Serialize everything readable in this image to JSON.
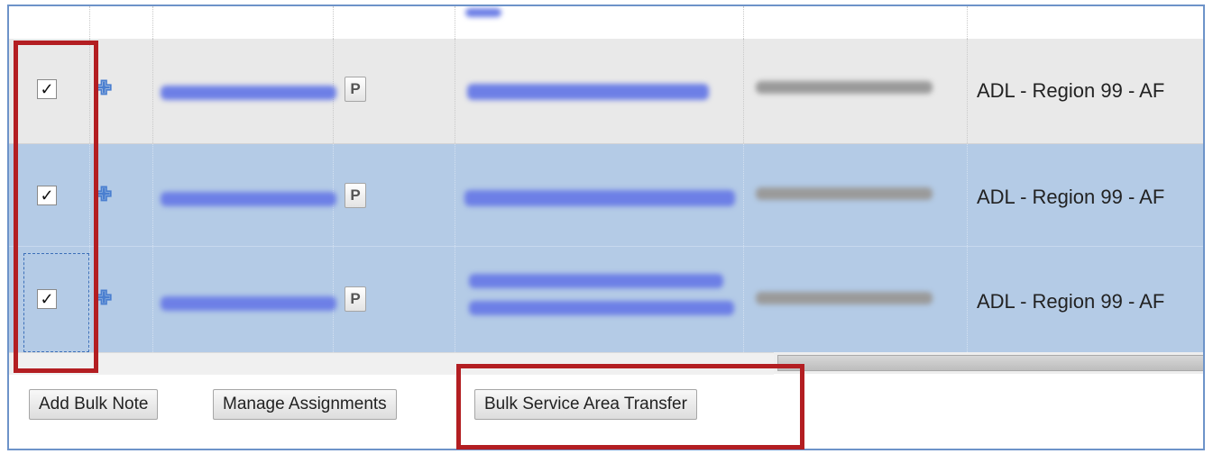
{
  "rows": [
    {
      "checked": true,
      "checkmark": "✓",
      "expand_glyph": "✙",
      "doc_icon_letter": "P",
      "region": "ADL - Region 99 - AF"
    },
    {
      "checked": true,
      "checkmark": "✓",
      "expand_glyph": "✙",
      "doc_icon_letter": "P",
      "region": "ADL - Region 99 - AF"
    },
    {
      "checked": true,
      "checkmark": "✓",
      "expand_glyph": "✙",
      "doc_icon_letter": "P",
      "region": "ADL - Region 99 - AF"
    }
  ],
  "toolbar": {
    "add_bulk_note": "Add Bulk Note",
    "manage_assignments": "Manage Assignments",
    "bulk_service_area_transfer": "Bulk Service Area Transfer"
  },
  "colors": {
    "selected_row": "#b4cbe6",
    "unselected_row": "#e9e9e9",
    "highlight_annotation": "#b31e22",
    "frame_border": "#6d93c9"
  },
  "icons": {
    "expand": "plus-expand-icon",
    "document": "document-p-icon",
    "checkbox": "checkbox-checked"
  }
}
